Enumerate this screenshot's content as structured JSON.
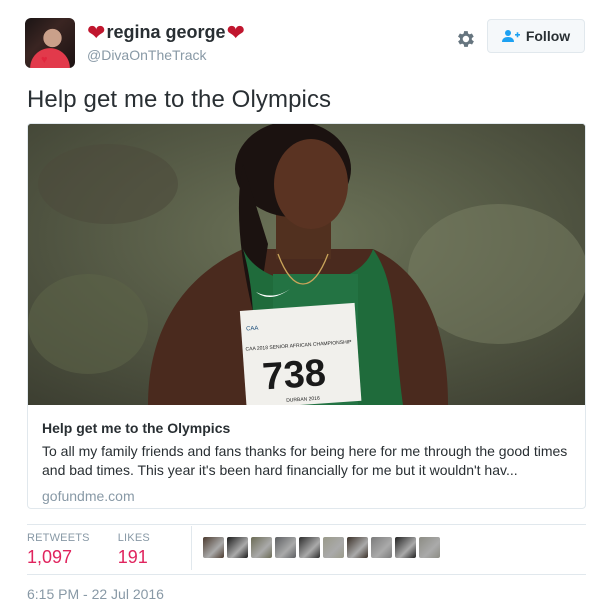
{
  "user": {
    "display_name": "regina george",
    "handle": "@DivaOnTheTrack",
    "name_decoration_icon": "heart-icon"
  },
  "follow_button": {
    "label": "Follow",
    "icon": "add-user-icon"
  },
  "tweet": {
    "text": "Help get me to the Olympics"
  },
  "card": {
    "title": "Help get me to the Olympics",
    "description": "To all my family friends and fans thanks for being here for me through the good times and bad times. This year it's been hard financially for me but it wouldn't hav...",
    "domain": "gofundme.com",
    "bib": {
      "number": "738",
      "event_text": "CAA 2018 SENIOR AFRICAN CHAMPIONSHIP",
      "city": "DURBAN 2016",
      "logo_text": "CAA"
    }
  },
  "stats": {
    "retweets_label": "RETWEETS",
    "retweets_value": "1,097",
    "likes_label": "LIKES",
    "likes_value": "191"
  },
  "likers": [
    {
      "color": "#4b3a2e"
    },
    {
      "color": "#1b1b1b"
    },
    {
      "color": "#6b6b55"
    },
    {
      "color": "#5d5f62"
    },
    {
      "color": "#2c2c2c"
    },
    {
      "color": "#9a9a8a"
    },
    {
      "color": "#3a3028"
    },
    {
      "color": "#7b7b7b"
    },
    {
      "color": "#222222"
    },
    {
      "color": "#8c8c84"
    }
  ],
  "timestamp": "6:15 PM - 22 Jul 2016",
  "colors": {
    "accent": "#e0245e",
    "muted": "#8899a6",
    "text": "#292f33",
    "heart": "#c0162e"
  }
}
